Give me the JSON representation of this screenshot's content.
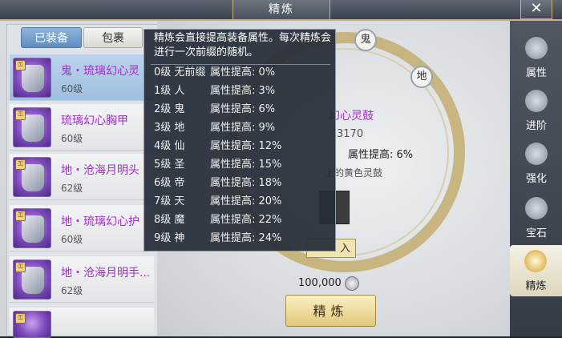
{
  "window": {
    "title": "精炼",
    "close_icon": "close-icon"
  },
  "tabs": {
    "equipped": "已装备",
    "bag": "包裹"
  },
  "items": [
    {
      "name": "鬼・琉璃幻心灵",
      "level": "60级",
      "selected": true
    },
    {
      "name": "琉璃幻心胸甲",
      "level": "60级",
      "selected": false
    },
    {
      "name": "地・沧海月明头",
      "level": "62级",
      "selected": false
    },
    {
      "name": "地・琉璃幻心护",
      "level": "60级",
      "selected": false
    },
    {
      "name": "地・沧海月明手...",
      "level": "62级",
      "selected": false
    }
  ],
  "stage": {
    "orb_top": "鬼",
    "orb_right": "地",
    "equip_name": "幻心灵鼓",
    "power": "3170",
    "stat": "属性提高: 6%",
    "desc": "上的黄色灵鼓",
    "put_button": "入",
    "cost": "100,000",
    "refine_button": "精炼"
  },
  "nav": [
    {
      "label": "属性",
      "icon": "attribute-icon"
    },
    {
      "label": "进阶",
      "icon": "advance-icon"
    },
    {
      "label": "强化",
      "icon": "strengthen-icon"
    },
    {
      "label": "宝石",
      "icon": "gem-icon"
    },
    {
      "label": "精炼",
      "icon": "refine-icon",
      "active": true
    }
  ],
  "tooltip": {
    "desc": "精炼会直接提高装备属性。每次精炼会进行一次前缀的随机。",
    "rows": [
      {
        "level": "0级 无前缀",
        "stat": "属性提高: 0%"
      },
      {
        "level": "1级 人",
        "stat": "属性提高: 3%"
      },
      {
        "level": "2级 鬼",
        "stat": "属性提高: 6%"
      },
      {
        "level": "3级 地",
        "stat": "属性提高: 9%"
      },
      {
        "level": "4级 仙",
        "stat": "属性提高: 12%"
      },
      {
        "level": "5级 圣",
        "stat": "属性提高: 15%"
      },
      {
        "level": "6级 帝",
        "stat": "属性提高: 18%"
      },
      {
        "level": "7级 天",
        "stat": "属性提高: 20%"
      },
      {
        "level": "8级 魔",
        "stat": "属性提高: 22%"
      },
      {
        "level": "9级 神",
        "stat": "属性提高: 24%"
      }
    ]
  }
}
